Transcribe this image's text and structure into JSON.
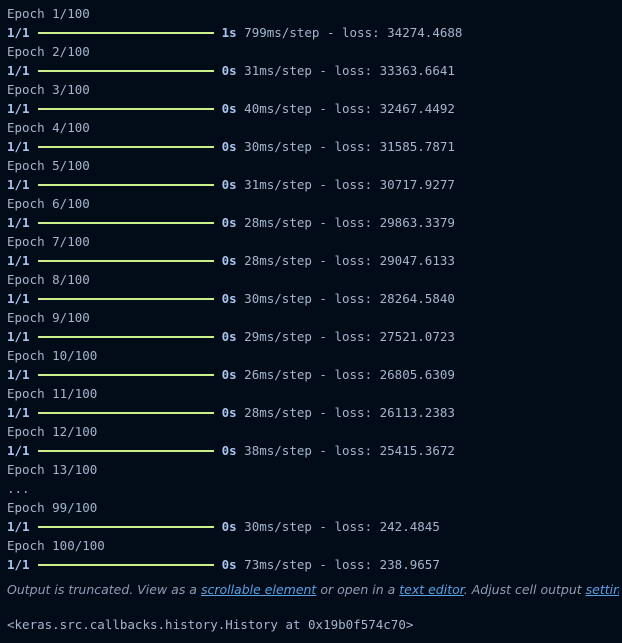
{
  "output": {
    "lines": [
      {
        "kind": "epoch",
        "text": "Epoch 1/100"
      },
      {
        "kind": "step",
        "step": "1/1",
        "time": "1s",
        "detail": "799ms/step - loss: 34274.4688"
      },
      {
        "kind": "epoch",
        "text": "Epoch 2/100"
      },
      {
        "kind": "step",
        "step": "1/1",
        "time": "0s",
        "detail": "31ms/step - loss: 33363.6641"
      },
      {
        "kind": "epoch",
        "text": "Epoch 3/100"
      },
      {
        "kind": "step",
        "step": "1/1",
        "time": "0s",
        "detail": "40ms/step - loss: 32467.4492"
      },
      {
        "kind": "epoch",
        "text": "Epoch 4/100"
      },
      {
        "kind": "step",
        "step": "1/1",
        "time": "0s",
        "detail": "30ms/step - loss: 31585.7871"
      },
      {
        "kind": "epoch",
        "text": "Epoch 5/100"
      },
      {
        "kind": "step",
        "step": "1/1",
        "time": "0s",
        "detail": "31ms/step - loss: 30717.9277"
      },
      {
        "kind": "epoch",
        "text": "Epoch 6/100"
      },
      {
        "kind": "step",
        "step": "1/1",
        "time": "0s",
        "detail": "28ms/step - loss: 29863.3379"
      },
      {
        "kind": "epoch",
        "text": "Epoch 7/100"
      },
      {
        "kind": "step",
        "step": "1/1",
        "time": "0s",
        "detail": "28ms/step - loss: 29047.6133"
      },
      {
        "kind": "epoch",
        "text": "Epoch 8/100"
      },
      {
        "kind": "step",
        "step": "1/1",
        "time": "0s",
        "detail": "30ms/step - loss: 28264.5840"
      },
      {
        "kind": "epoch",
        "text": "Epoch 9/100"
      },
      {
        "kind": "step",
        "step": "1/1",
        "time": "0s",
        "detail": "29ms/step - loss: 27521.0723"
      },
      {
        "kind": "epoch",
        "text": "Epoch 10/100"
      },
      {
        "kind": "step",
        "step": "1/1",
        "time": "0s",
        "detail": "26ms/step - loss: 26805.6309"
      },
      {
        "kind": "epoch",
        "text": "Epoch 11/100"
      },
      {
        "kind": "step",
        "step": "1/1",
        "time": "0s",
        "detail": "28ms/step - loss: 26113.2383"
      },
      {
        "kind": "epoch",
        "text": "Epoch 12/100"
      },
      {
        "kind": "step",
        "step": "1/1",
        "time": "0s",
        "detail": "38ms/step - loss: 25415.3672"
      },
      {
        "kind": "epoch",
        "text": "Epoch 13/100"
      },
      {
        "kind": "epoch",
        "text": "..."
      },
      {
        "kind": "epoch",
        "text": "Epoch 99/100"
      },
      {
        "kind": "step",
        "step": "1/1",
        "time": "0s",
        "detail": "30ms/step - loss: 242.4845"
      },
      {
        "kind": "epoch",
        "text": "Epoch 100/100"
      },
      {
        "kind": "step",
        "step": "1/1",
        "time": "0s",
        "detail": "73ms/step - loss: 238.9657"
      }
    ]
  },
  "notice": {
    "prefix": "Output is truncated. View as a ",
    "scrollable_link": "scrollable element",
    "middle": " or open in a ",
    "editor_link": "text editor",
    "suffix": ". Adjust cell output ",
    "settings_link": "settings",
    "ellipsis": "..."
  },
  "result": "<keras.src.callbacks.history.History at 0x19b0f574c70>",
  "colors": {
    "background": "#020c18",
    "text": "#a4b5cc",
    "progress_bar": "#c9f08a",
    "link": "#5aa2e6"
  }
}
